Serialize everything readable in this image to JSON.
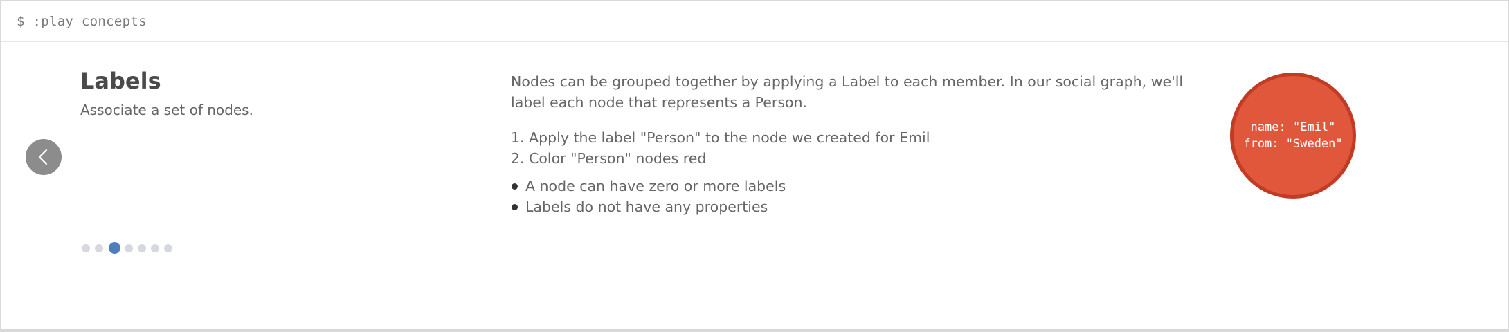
{
  "command_bar": {
    "text": "$ :play concepts"
  },
  "slide": {
    "title": "Labels",
    "subtitle": "Associate a set of nodes.",
    "description": "Nodes can be grouped together by applying a Label to each member. In our social graph, we'll label each node that represents a Person.",
    "steps": [
      "1. Apply the label \"Person\" to the node we created for Emil",
      "2. Color \"Person\" nodes red"
    ],
    "notes": [
      "A node can have zero or more labels",
      "Labels do not have any properties"
    ]
  },
  "pagination": {
    "total": 7,
    "active_index": 2
  },
  "node": {
    "line1": "name: \"Emil\"",
    "line2": "from: \"Sweden\"",
    "fill_color": "#e0573b",
    "border_color": "#c13c25"
  },
  "icons": {
    "prev": "chevron-left-icon"
  },
  "colors": {
    "accent": "#4f7dbf",
    "dot_inactive": "#d5d8de",
    "nav_button": "#8c8c8c"
  }
}
